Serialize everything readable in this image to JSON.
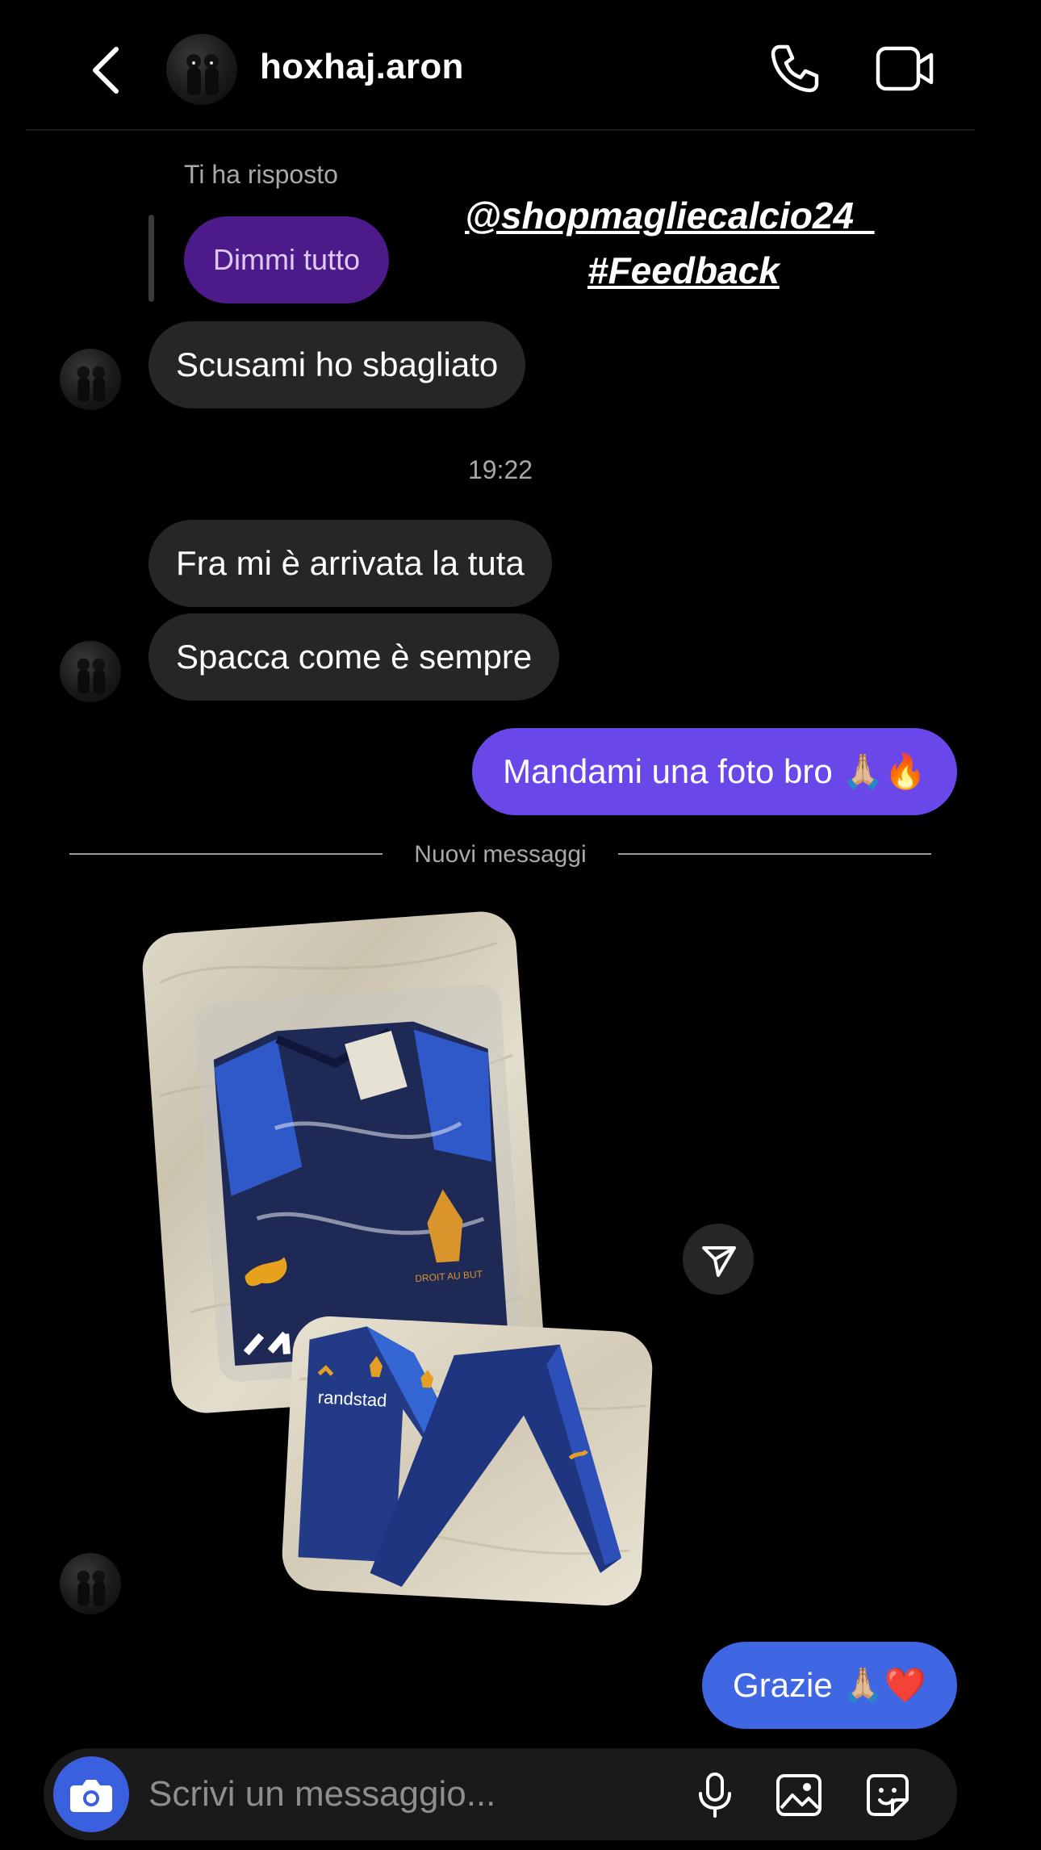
{
  "header": {
    "username": "hoxhaj.aron",
    "icons": [
      "back-chevron-icon",
      "phone-icon",
      "video-camera-icon"
    ]
  },
  "reply": {
    "label": "Ti ha risposto",
    "text": "Dimmi tutto"
  },
  "overlay": {
    "mention": "@shopmagliecalcio24_",
    "hashtag": "#Feedback"
  },
  "messages": [
    {
      "from": "them",
      "text": "Scusami ho sbagliato"
    },
    {
      "from": "them",
      "text": "Fra mi è arrivata la tuta"
    },
    {
      "from": "them",
      "text": "Spacca come è sempre"
    },
    {
      "from": "me",
      "text": "Mandami una foto bro 🙏🏼🔥"
    },
    {
      "from": "me",
      "text": "Grazie 🙏🏼❤️"
    }
  ],
  "timestamp": "19:22",
  "separator": "Nuovi messaggi",
  "photo_message": {
    "brand_text": "randstad",
    "crest_text": "DROIT AU BUT"
  },
  "composer": {
    "placeholder": "Scrivi un messaggio...",
    "icons": [
      "camera-icon",
      "microphone-icon",
      "gallery-icon",
      "sticker-icon"
    ]
  },
  "colors": {
    "background": "#000000",
    "bubble_in": "#262626",
    "reply_bubble": "#4d1a8a",
    "bubble_out_purple": "#6a47e8",
    "bubble_out_blue": "#3f66e3",
    "camera_button": "#3a60e0"
  }
}
